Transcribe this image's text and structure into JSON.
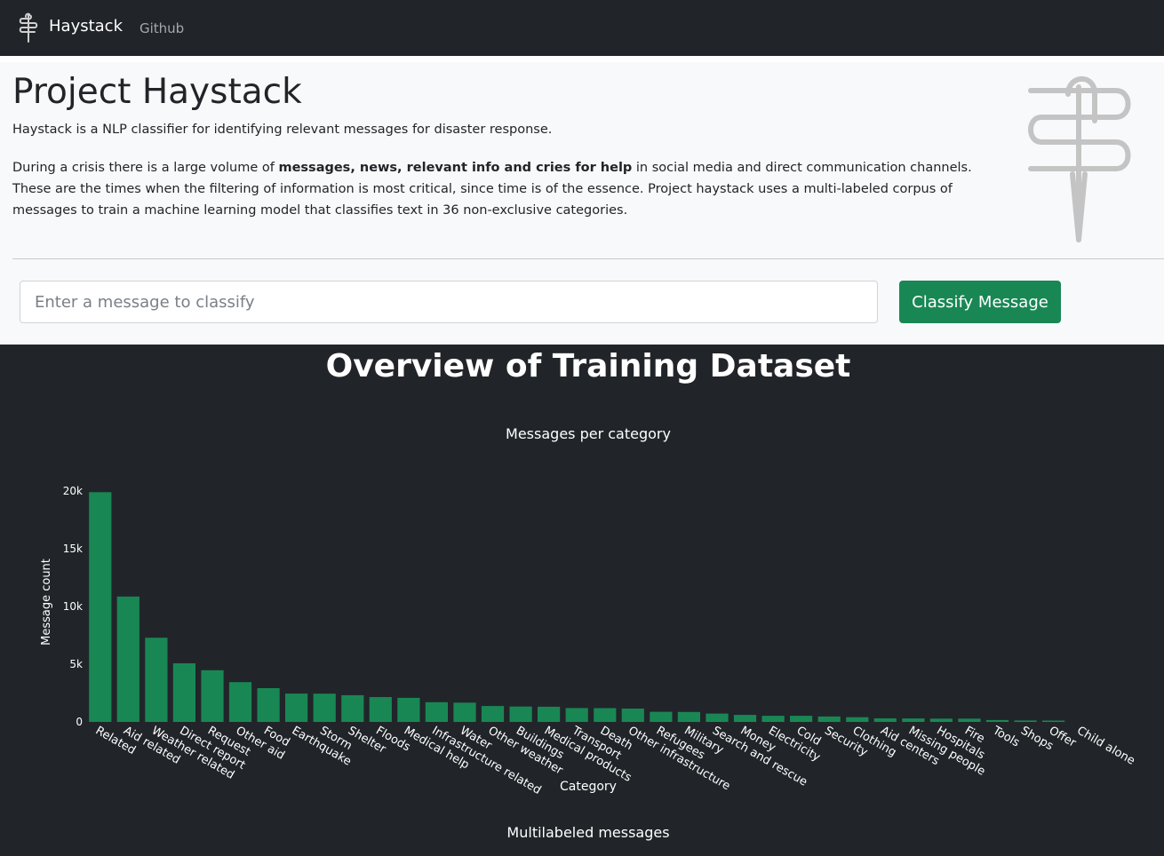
{
  "navbar": {
    "brand": "Haystack",
    "github_link": "Github",
    "logo_icon": "needle-thread-icon"
  },
  "hero": {
    "title": "Project Haystack",
    "lead": "Haystack is a NLP classifier for identifying relevant messages for disaster response.",
    "desc_before": "During a crisis there is a large volume of ",
    "desc_bold": "messages, news, relevant info and cries for help",
    "desc_after": " in social media and direct communication channels. These are the times when the filtering of information is most critical, since time is of the essence. Project haystack uses a multi-labeled corpus of messages to train a machine learning model that classifies text in 36 non-exclusive categories.",
    "input_placeholder": "Enter a message to classify",
    "input_value": "",
    "button_label": "Classify Message"
  },
  "colors": {
    "accent": "#198754",
    "dark": "#212529",
    "light": "#f8f9fa"
  },
  "overview": {
    "title": "Overview of Training Dataset",
    "second_chart_title": "Multilabeled messages"
  },
  "chart_data": {
    "type": "bar",
    "title": "Messages per category",
    "xlabel": "Category",
    "ylabel": "Message count",
    "ylim": [
      0,
      20400
    ],
    "yticks": [
      0,
      5000,
      10000,
      15000,
      20000
    ],
    "ytick_labels": [
      "0",
      "5k",
      "10k",
      "15k",
      "20k"
    ],
    "color": "#198754",
    "categories": [
      "Related",
      "Aid related",
      "Weather related",
      "Direct report",
      "Request",
      "Other aid",
      "Food",
      "Earthquake",
      "Storm",
      "Shelter",
      "Floods",
      "Medical help",
      "Infrastructure related",
      "Water",
      "Other weather",
      "Buildings",
      "Medical products",
      "Transport",
      "Death",
      "Other infrastructure",
      "Refugees",
      "Military",
      "Search and rescue",
      "Money",
      "Electricity",
      "Cold",
      "Security",
      "Clothing",
      "Aid centers",
      "Missing people",
      "Hospitals",
      "Fire",
      "Tools",
      "Shops",
      "Offer",
      "Child alone"
    ],
    "values": [
      19900,
      10860,
      7290,
      5075,
      4474,
      3446,
      2923,
      2455,
      2443,
      2314,
      2155,
      2084,
      1705,
      1672,
      1376,
      1333,
      1313,
      1201,
      1194,
      1151,
      875,
      860,
      724,
      604,
      532,
      530,
      471,
      405,
      309,
      298,
      283,
      282,
      159,
      120,
      118,
      0
    ]
  }
}
